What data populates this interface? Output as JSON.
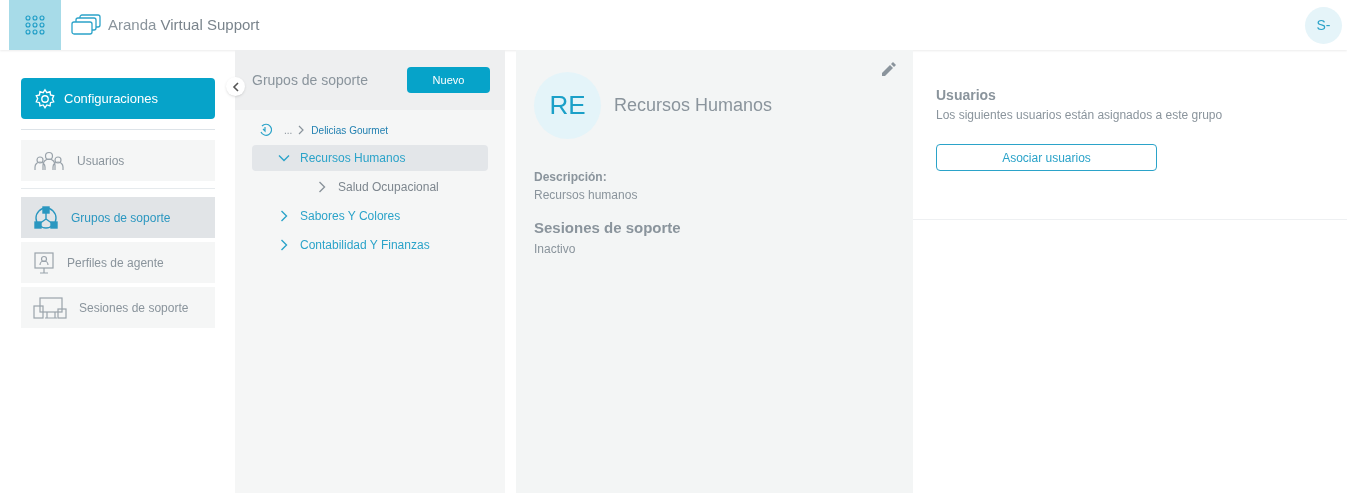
{
  "header": {
    "app_name_light": "Aranda",
    "app_name_bold": "Virtual Support",
    "avatar": "S-"
  },
  "sidebar": {
    "main": {
      "label": "Configuraciones"
    },
    "sections": [
      {
        "items": [
          {
            "label": "Usuarios",
            "selected": false
          }
        ]
      },
      {
        "items": [
          {
            "label": "Grupos de soporte",
            "selected": true
          },
          {
            "label": "Perfiles de agente",
            "selected": false
          },
          {
            "label": "Sesiones de soporte",
            "selected": false
          }
        ]
      }
    ]
  },
  "tree_panel": {
    "title": "Grupos de soporte",
    "new_button": "Nuevo",
    "breadcrumb": {
      "ellipsis": "...",
      "parent": "Delicias Gourmet"
    },
    "tree": [
      {
        "label": "Recursos Humanos",
        "expanded": true,
        "selected": true,
        "children": [
          {
            "label": "Salud Ocupacional",
            "expanded": false,
            "selected": false
          }
        ]
      },
      {
        "label": "Sabores Y Colores",
        "expanded": false,
        "selected": false
      },
      {
        "label": "Contabilidad Y Finanzas",
        "expanded": false,
        "selected": false
      }
    ]
  },
  "detail": {
    "initials": "RE",
    "name": "Recursos Humanos",
    "description_label": "Descripción:",
    "description": "Recursos humanos",
    "sessions_label": "Sesiones de soporte",
    "sessions_value": "Inactivo"
  },
  "users_panel": {
    "title": "Usuarios",
    "subtitle": "Los siguientes usuarios están asignados a este grupo",
    "button": "Asociar usuarios"
  }
}
